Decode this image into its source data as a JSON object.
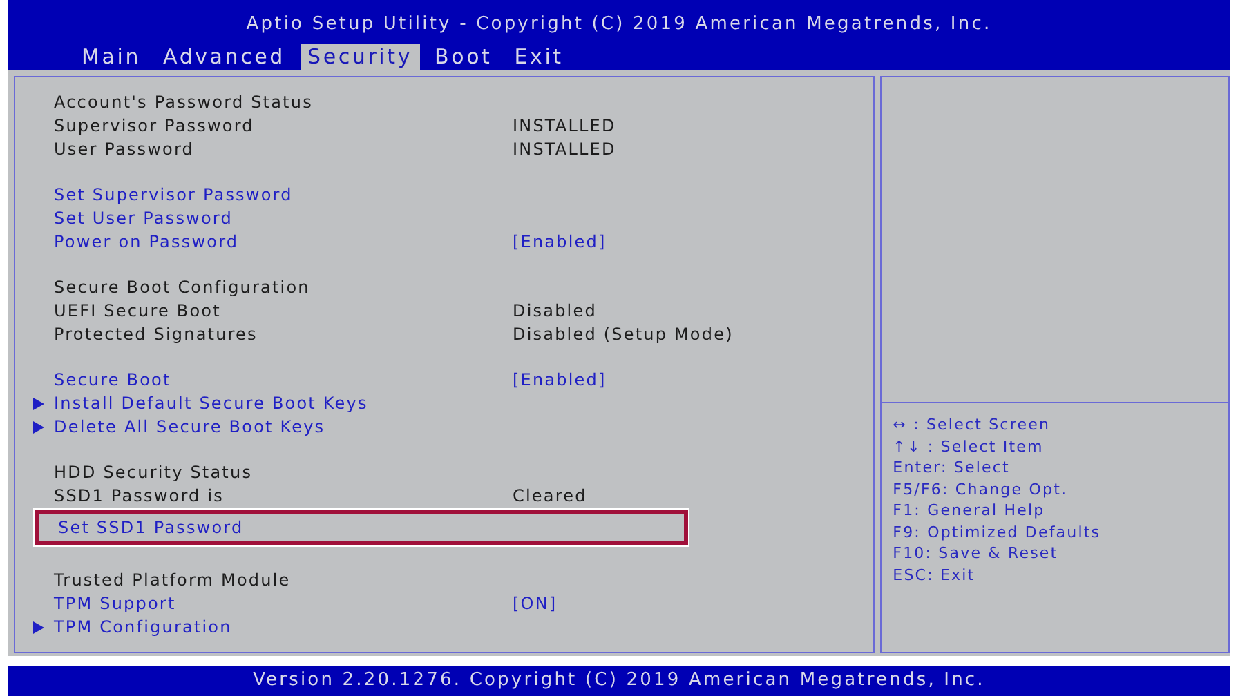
{
  "title": "Aptio Setup Utility - Copyright (C) 2019 American Megatrends, Inc.",
  "tabs": [
    {
      "label": "Main",
      "selected": false
    },
    {
      "label": "Advanced",
      "selected": false
    },
    {
      "label": "Security",
      "selected": true
    },
    {
      "label": "Boot",
      "selected": false
    },
    {
      "label": "Exit",
      "selected": false
    }
  ],
  "sections": [
    {
      "items": [
        {
          "kind": "header",
          "label": "Account's Password Status"
        },
        {
          "kind": "info",
          "label": "Supervisor Password",
          "value": "INSTALLED"
        },
        {
          "kind": "info",
          "label": "User Password",
          "value": "INSTALLED"
        }
      ]
    },
    {
      "items": [
        {
          "kind": "option",
          "label": "Set Supervisor Password",
          "submenu": false,
          "highlighted": false
        },
        {
          "kind": "option",
          "label": "Set User Password",
          "submenu": false,
          "highlighted": false
        },
        {
          "kind": "option",
          "label": "Power on Password",
          "value": "[Enabled]",
          "submenu": false,
          "highlighted": false
        }
      ]
    },
    {
      "items": [
        {
          "kind": "header",
          "label": "Secure Boot Configuration"
        },
        {
          "kind": "info",
          "label": "UEFI Secure Boot",
          "value": "Disabled"
        },
        {
          "kind": "info",
          "label": "Protected Signatures",
          "value": "Disabled (Setup Mode)"
        }
      ]
    },
    {
      "items": [
        {
          "kind": "option",
          "label": "Secure Boot",
          "value": "[Enabled]",
          "submenu": false,
          "highlighted": false
        },
        {
          "kind": "option",
          "label": "Install Default Secure Boot Keys",
          "submenu": true,
          "highlighted": false
        },
        {
          "kind": "option",
          "label": "Delete All Secure Boot Keys",
          "submenu": true,
          "highlighted": false
        }
      ]
    },
    {
      "items": [
        {
          "kind": "header",
          "label": "HDD Security Status"
        },
        {
          "kind": "info",
          "label": "SSD1 Password is",
          "value": "Cleared"
        },
        {
          "kind": "option",
          "label": "Set SSD1 Password",
          "submenu": false,
          "highlighted": true
        }
      ]
    },
    {
      "items": [
        {
          "kind": "header",
          "label": "Trusted Platform Module"
        },
        {
          "kind": "option",
          "label": "TPM Support",
          "value": "[ON]",
          "submenu": false,
          "highlighted": false
        },
        {
          "kind": "option",
          "label": "TPM Configuration",
          "submenu": true,
          "highlighted": false
        }
      ]
    }
  ],
  "help": [
    "↔ : Select Screen",
    "↑↓ : Select Item",
    "Enter: Select",
    "F5/F6: Change Opt.",
    "F1: General Help",
    "F9: Optimized Defaults",
    "F10: Save & Reset",
    "ESC: Exit"
  ],
  "footer": "Version 2.20.1276. Copyright (C) 2019 American Megatrends, Inc."
}
